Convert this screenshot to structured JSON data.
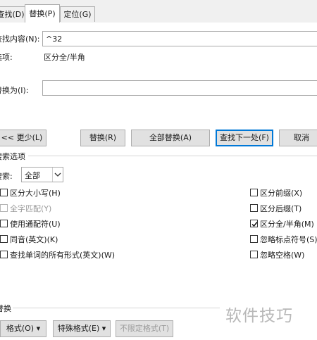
{
  "tabs": [
    "查找(D)",
    "替换(P)",
    "定位(G)"
  ],
  "find": {
    "label": "查找内容(N):",
    "value": "^32"
  },
  "options": {
    "label": "选项:",
    "value": "区分全/半角"
  },
  "replace": {
    "label": "替换为(I):",
    "value": ""
  },
  "buttons": {
    "less": "<< 更少(L)",
    "replace": "替换(R)",
    "replace_all": "全部替换(A)",
    "find_next": "查找下一处(F)",
    "cancel": "取消"
  },
  "search_options": {
    "title": "搜索选项",
    "search_label": "搜索:",
    "search_value": "全部"
  },
  "checkboxes_left": [
    {
      "label": "区分大小写(H)",
      "checked": false,
      "disabled": false
    },
    {
      "label": "全字匹配(Y)",
      "checked": false,
      "disabled": true
    },
    {
      "label": "使用通配符(U)",
      "checked": false,
      "disabled": false
    },
    {
      "label": "同音(英文)(K)",
      "checked": false,
      "disabled": false
    },
    {
      "label": "查找单词的所有形式(英文)(W)",
      "checked": false,
      "disabled": false
    }
  ],
  "checkboxes_right": [
    {
      "label": "区分前缀(X)",
      "checked": false,
      "disabled": false
    },
    {
      "label": "区分后缀(T)",
      "checked": false,
      "disabled": false
    },
    {
      "label": "区分全/半角(M)",
      "checked": true,
      "disabled": false
    },
    {
      "label": "忽略标点符号(S)",
      "checked": false,
      "disabled": false
    },
    {
      "label": "忽略空格(W)",
      "checked": false,
      "disabled": false
    }
  ],
  "replace_section": {
    "title": "替换",
    "format": "格式(O) ▾",
    "special": "特殊格式(E) ▾",
    "no_format": "不限定格式(T)"
  },
  "watermark": "软件技巧",
  "colors": {
    "accent": "#0078d7",
    "tab_bg": "#f0f0f0",
    "button_bg": "#e1e1e1"
  }
}
